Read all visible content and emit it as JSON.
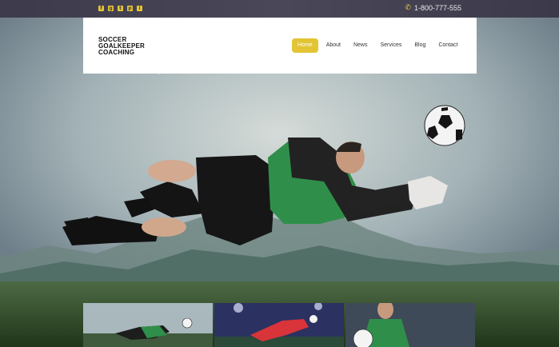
{
  "topbar": {
    "socials": [
      {
        "name": "facebook-icon",
        "glyph": "f"
      },
      {
        "name": "google-plus-icon",
        "glyph": "g"
      },
      {
        "name": "twitter-icon",
        "glyph": "t"
      },
      {
        "name": "pinterest-icon",
        "glyph": "p"
      },
      {
        "name": "instagram-icon",
        "glyph": "i"
      }
    ],
    "phone": "1-800-777-555",
    "accent": "#e5c638"
  },
  "header": {
    "logo_lines": [
      "SOCCER",
      "GOALKEEPER",
      "COACHING"
    ],
    "nav": [
      {
        "label": "Home",
        "active": true
      },
      {
        "label": "About",
        "active": false
      },
      {
        "label": "News",
        "active": false
      },
      {
        "label": "Services",
        "active": false
      },
      {
        "label": "Blog",
        "active": false
      },
      {
        "label": "Contact",
        "active": false
      }
    ],
    "accent": "#e3c534"
  },
  "hero": {
    "image": "goalkeeper-diving-for-ball"
  },
  "thumbnails": [
    {
      "image": "goalkeeper-diving-save"
    },
    {
      "image": "goalkeeper-red-kit-night"
    },
    {
      "image": "goalkeeper-holding-ball-rain"
    }
  ]
}
